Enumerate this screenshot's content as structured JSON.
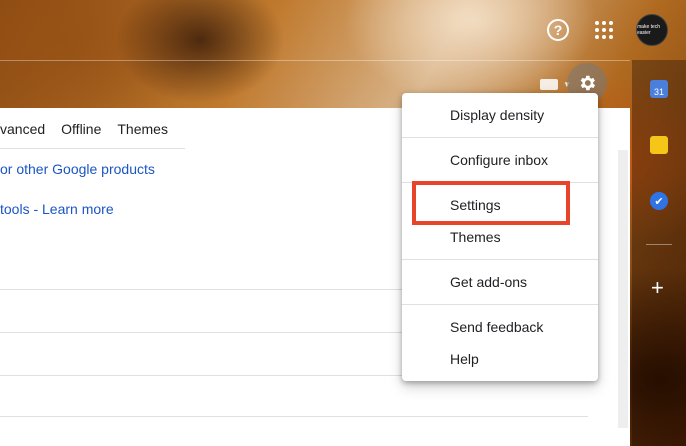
{
  "header": {
    "help_symbol": "?",
    "avatar_text": "make tech easier",
    "icons": [
      "help-icon",
      "apps-grid-icon",
      "avatar"
    ]
  },
  "toolbar": {
    "icons": [
      "keyboard-icon",
      "dropdown-caret-icon",
      "gear-icon"
    ]
  },
  "settings_tabs": [
    {
      "label": "vanced"
    },
    {
      "label": "Offline"
    },
    {
      "label": "Themes"
    }
  ],
  "main": {
    "link1": "or other Google products",
    "link2": "tools - Learn more"
  },
  "right_rail": {
    "calendar_day": "31",
    "tasks_mark": "✔",
    "add_symbol": "+"
  },
  "menu": {
    "items": [
      {
        "label": "Display density"
      },
      {
        "label": "Configure inbox"
      },
      {
        "label": "Settings"
      },
      {
        "label": "Themes"
      },
      {
        "label": "Get add-ons"
      },
      {
        "label": "Send feedback"
      },
      {
        "label": "Help"
      }
    ]
  },
  "colors": {
    "highlight": "#e8442c",
    "link": "#1a56c4"
  }
}
